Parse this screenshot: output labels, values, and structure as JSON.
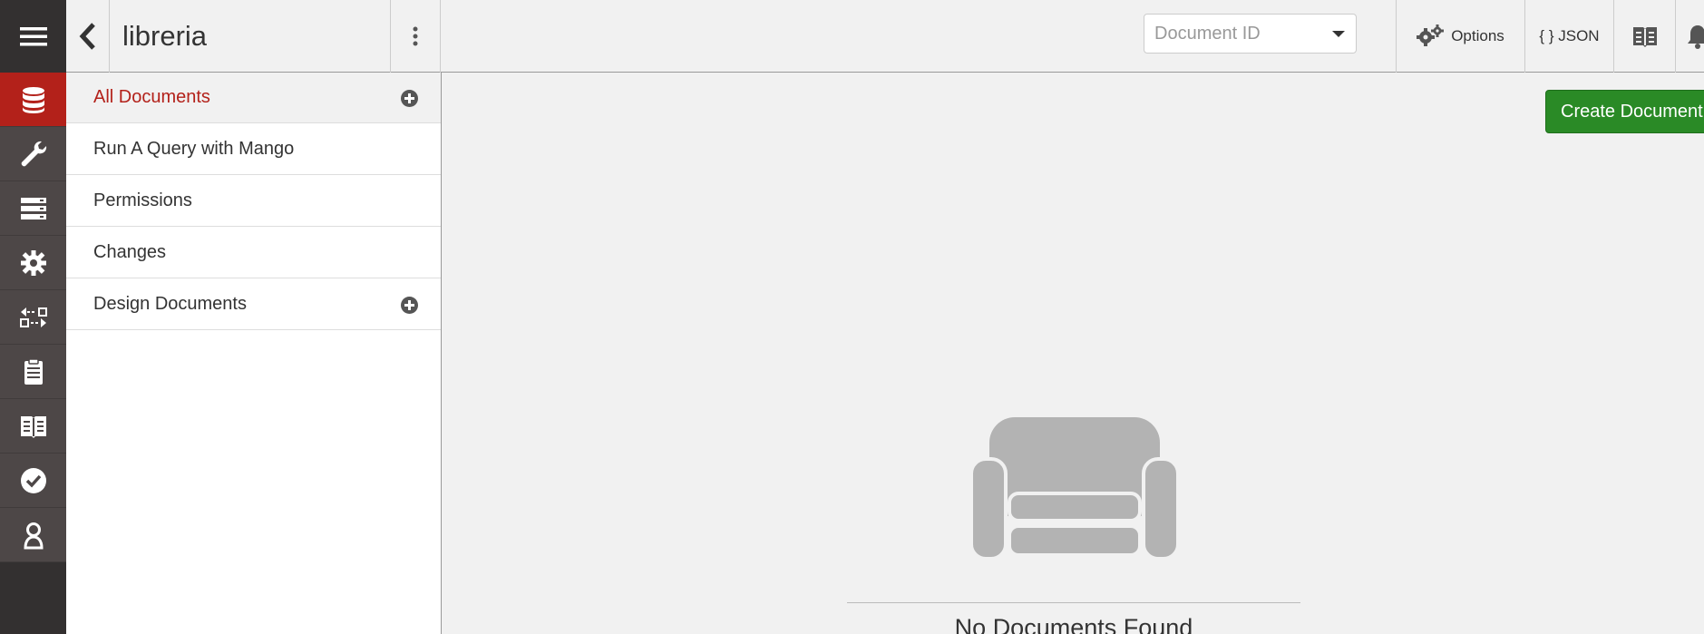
{
  "app": {
    "database_name": "libreria"
  },
  "rail": {
    "items": [
      {
        "icon": "hamburger-icon"
      },
      {
        "icon": "database-icon",
        "active": true
      },
      {
        "icon": "wrench-icon"
      },
      {
        "icon": "server-icon"
      },
      {
        "icon": "gear-icon"
      },
      {
        "icon": "replication-icon"
      },
      {
        "icon": "clipboard-icon"
      },
      {
        "icon": "book-icon"
      },
      {
        "icon": "check-circle-icon"
      },
      {
        "icon": "user-icon"
      }
    ]
  },
  "header": {
    "doc_id_placeholder": "Document ID",
    "options_label": "Options",
    "json_label": "{ } JSON"
  },
  "sidebar": {
    "items": [
      {
        "label": "All Documents",
        "active": true,
        "has_add": true
      },
      {
        "label": "Run A Query with Mango"
      },
      {
        "label": "Permissions"
      },
      {
        "label": "Changes"
      },
      {
        "label": "Design Documents",
        "has_add": true
      }
    ]
  },
  "main": {
    "create_button_label": "Create Document",
    "empty_message": "No Documents Found"
  },
  "colors": {
    "accent_red": "#b3211a",
    "create_green": "#2a8a26",
    "rail_dark": "#333030"
  }
}
